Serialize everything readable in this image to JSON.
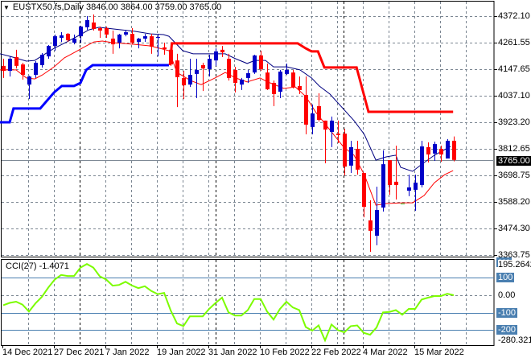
{
  "header": {
    "symbol": "EUSTX50.fs,Daily",
    "open": "3846.00",
    "high": "3864.00",
    "low": "3759.00",
    "close": "3765.00"
  },
  "colors": {
    "bull": "#0000c8",
    "bear": "#ff0000",
    "doji": "#32cd32",
    "ma_fast": "#000080",
    "ma_slow": "#ff0000",
    "stop_long": "#0000ff",
    "stop_short": "#ff0000",
    "cci": "#7cfc00",
    "grid": "#7a8591",
    "level": "#4a7fb0",
    "separator": "#000000"
  },
  "price_axis": {
    "labels": [
      "4372.10",
      "4261.55",
      "4147.65",
      "4037.10",
      "3923.20",
      "3812.65",
      "3698.75",
      "3588.20",
      "3474.30",
      "3363.75"
    ],
    "current": "3765.00"
  },
  "cci_panel": {
    "name": "CCI(27)",
    "value": "-1.4071",
    "axis_max": "195.2642",
    "axis_min": "-280.3219",
    "levels": [
      "200",
      "100",
      "0.00",
      "-100",
      "-200"
    ]
  },
  "date_axis": {
    "labels": [
      "14 Dec 2021",
      "27 Dec 2021",
      "7 Jan 2022",
      "19 Jan 2022",
      "31 Jan 2022",
      "10 Feb 2022",
      "22 Feb 2022",
      "4 Mar 2022",
      "15 Mar 2022"
    ]
  },
  "chart_data": [
    {
      "type": "candlestick",
      "title": "EUSTX50.fs,Daily",
      "ylim": [
        3353.6,
        4440
      ],
      "ohlc_order": [
        "open",
        "high",
        "low",
        "close"
      ],
      "candles": [
        [
          4162,
          4192,
          4111,
          4141
        ],
        [
          4141,
          4202,
          4117,
          4192
        ],
        [
          4199,
          4230,
          4151,
          4162
        ],
        [
          4168,
          4175,
          4104,
          4124
        ],
        [
          4083,
          4120,
          4022,
          4117
        ],
        [
          4124,
          4182,
          4111,
          4175
        ],
        [
          4165,
          4216,
          4155,
          4209
        ],
        [
          4202,
          4250,
          4192,
          4246
        ],
        [
          4246,
          4294,
          4226,
          4287
        ],
        [
          4280,
          4304,
          4263,
          4291
        ],
        [
          4297,
          4301,
          4263,
          4270
        ],
        [
          4260,
          4294,
          4253,
          4277
        ],
        [
          4287,
          4331,
          4260,
          4328
        ],
        [
          4325,
          4372,
          4314,
          4355
        ],
        [
          4345,
          4379,
          4311,
          4318
        ],
        [
          4321,
          4328,
          4280,
          4311
        ],
        [
          4321,
          4328,
          4280,
          4294
        ],
        [
          4277,
          4311,
          4213,
          4253
        ],
        [
          4260,
          4297,
          4236,
          4294
        ],
        [
          4294,
          4314,
          4287,
          4304
        ],
        [
          4297,
          4321,
          4253,
          4260
        ],
        [
          4263,
          4280,
          4236,
          4277
        ],
        [
          4277,
          4297,
          4263,
          4287
        ],
        [
          4287,
          4297,
          4213,
          4243
        ],
        [
          4280,
          4294,
          4202,
          4284
        ],
        [
          4240,
          4260,
          4209,
          4233
        ],
        [
          4230,
          4243,
          4162,
          4168
        ],
        [
          4185,
          4213,
          3988,
          4114
        ],
        [
          4111,
          4141,
          4022,
          4080
        ],
        [
          4083,
          4192,
          4073,
          4124
        ],
        [
          4128,
          4192,
          4026,
          4145
        ],
        [
          4165,
          4175,
          4056,
          4151
        ],
        [
          4148,
          4209,
          4117,
          4192
        ],
        [
          4185,
          4236,
          4162,
          4223
        ],
        [
          4230,
          4246,
          4199,
          4219
        ],
        [
          4192,
          4213,
          4100,
          4111
        ],
        [
          4145,
          4158,
          4050,
          4090
        ],
        [
          4083,
          4111,
          4060,
          4104
        ],
        [
          4111,
          4145,
          4090,
          4131
        ],
        [
          4134,
          4209,
          4128,
          4206
        ],
        [
          4206,
          4226,
          4141,
          4148
        ],
        [
          4134,
          4172,
          4060,
          4063
        ],
        [
          4090,
          4100,
          3992,
          4043
        ],
        [
          4053,
          4145,
          4026,
          4138
        ],
        [
          4128,
          4172,
          4124,
          4145
        ],
        [
          4134,
          4145,
          4067,
          4073
        ],
        [
          4077,
          4117,
          4043,
          4060
        ],
        [
          4039,
          4117,
          3873,
          3914
        ],
        [
          3904,
          3999,
          3873,
          3961
        ],
        [
          3992,
          4046,
          3927,
          3934
        ],
        [
          3931,
          3931,
          3751,
          3893
        ],
        [
          3883,
          3948,
          3819,
          3931
        ],
        [
          3876,
          3931,
          3836,
          3870
        ],
        [
          3876,
          3897,
          3700,
          3737
        ],
        [
          3741,
          3846,
          3710,
          3819
        ],
        [
          3812,
          3846,
          3703,
          3724
        ],
        [
          3710,
          3710,
          3523,
          3567
        ],
        [
          3510,
          3595,
          3377,
          3466
        ],
        [
          3445,
          3652,
          3405,
          3554
        ],
        [
          3564,
          3805,
          3547,
          3747
        ],
        [
          3764,
          3764,
          3618,
          3659
        ],
        [
          3673,
          3825,
          3598,
          3659
        ],
        [
          3581,
          3581,
          3581,
          3581
        ],
        [
          3635,
          3703,
          3612,
          3649
        ],
        [
          3639,
          3703,
          3550,
          3669
        ],
        [
          3659,
          3846,
          3649,
          3822
        ],
        [
          3819,
          3839,
          3754,
          3788
        ],
        [
          3792,
          3842,
          3761,
          3832
        ],
        [
          3812,
          3825,
          3757,
          3788
        ],
        [
          3771,
          3853,
          3771,
          3846
        ],
        [
          3846,
          3864,
          3759,
          3765
        ]
      ],
      "overlays": [
        {
          "name": "ma_fast",
          "points": [
            [
              -0.5,
              4213
            ],
            [
              1.1,
              4202
            ],
            [
              3.6,
              4182
            ],
            [
              4.9,
              4185
            ],
            [
              7.9,
              4236
            ],
            [
              9.9,
              4263
            ],
            [
              12,
              4294
            ],
            [
              13.3,
              4314
            ],
            [
              14.9,
              4325
            ],
            [
              17,
              4318
            ],
            [
              20.4,
              4308
            ],
            [
              22.9,
              4297
            ],
            [
              24.9,
              4294
            ],
            [
              25.75,
              4287
            ],
            [
              27.9,
              4226
            ],
            [
              29.5,
              4213
            ],
            [
              32,
              4213
            ],
            [
              34.5,
              4213
            ],
            [
              36.1,
              4192
            ],
            [
              37.9,
              4172
            ],
            [
              39.1,
              4185
            ],
            [
              40.75,
              4185
            ],
            [
              42,
              4158
            ],
            [
              44.1,
              4158
            ],
            [
              46.1,
              4145
            ],
            [
              47.9,
              4111
            ],
            [
              49.1,
              4077
            ],
            [
              50.75,
              4043
            ],
            [
              54.5,
              3931
            ],
            [
              56.1,
              3873
            ],
            [
              57.9,
              3764
            ],
            [
              59.5,
              3778
            ],
            [
              61,
              3785
            ],
            [
              61.75,
              3734
            ],
            [
              63.6,
              3717
            ],
            [
              64.9,
              3744
            ],
            [
              67,
              3785
            ],
            [
              69.5,
              3822
            ]
          ]
        },
        {
          "name": "ma_slow",
          "points": [
            [
              -0.5,
              4145
            ],
            [
              2,
              4145
            ],
            [
              3.6,
              4111
            ],
            [
              4.9,
              4107
            ],
            [
              6.1,
              4124
            ],
            [
              7.9,
              4158
            ],
            [
              9.5,
              4196
            ],
            [
              11.1,
              4219
            ],
            [
              12.9,
              4246
            ],
            [
              14.1,
              4263
            ],
            [
              15.4,
              4267
            ],
            [
              17,
              4260
            ],
            [
              20.4,
              4253
            ],
            [
              22.9,
              4246
            ],
            [
              25.75,
              4226
            ],
            [
              27,
              4134
            ],
            [
              29.1,
              4100
            ],
            [
              30.75,
              4083
            ],
            [
              32.9,
              4111
            ],
            [
              34.5,
              4134
            ],
            [
              36.1,
              4111
            ],
            [
              37.9,
              4094
            ],
            [
              39.9,
              4111
            ],
            [
              41.1,
              4094
            ],
            [
              43.6,
              4067
            ],
            [
              45.4,
              4073
            ],
            [
              47,
              4033
            ],
            [
              48.6,
              3965
            ],
            [
              50.4,
              3904
            ],
            [
              51.1,
              3880
            ],
            [
              52.9,
              3819
            ],
            [
              54.5,
              3785
            ],
            [
              56.1,
              3703
            ],
            [
              57.9,
              3574
            ],
            [
              59.5,
              3581
            ],
            [
              62,
              3584
            ],
            [
              63.6,
              3584
            ],
            [
              65.4,
              3615
            ],
            [
              67,
              3669
            ],
            [
              68.6,
              3703
            ],
            [
              69.9,
              3720
            ]
          ]
        },
        {
          "name": "stop_long",
          "points": [
            [
              -0.5,
              3924
            ],
            [
              1,
              3924
            ],
            [
              1.6,
              3982
            ],
            [
              5.75,
              3982
            ],
            [
              7.9,
              4050
            ],
            [
              9.1,
              4077
            ],
            [
              11,
              4077
            ],
            [
              12,
              4090
            ],
            [
              12.9,
              4145
            ],
            [
              13.9,
              4165
            ],
            [
              25.75,
              4165
            ]
          ]
        },
        {
          "name": "stop_short",
          "points": [
            [
              25.9,
              4165
            ],
            [
              26.2,
              4257
            ],
            [
              45.75,
              4257
            ],
            [
              47,
              4236
            ],
            [
              47.9,
              4223
            ],
            [
              48.9,
              4223
            ],
            [
              49.9,
              4155
            ],
            [
              54.9,
              4155
            ],
            [
              56.75,
              3968
            ],
            [
              69.9,
              3968
            ]
          ]
        }
      ],
      "current_price": 3765
    },
    {
      "type": "line",
      "title": "CCI(27)",
      "ylim": [
        -280.3219,
        195.2642
      ],
      "levels": [
        100,
        0,
        -100,
        -200
      ],
      "values": [
        -58,
        -45,
        -38,
        -55,
        -94,
        -48,
        -11,
        42,
        88,
        114,
        108,
        108,
        156,
        176,
        156,
        106,
        88,
        53,
        57,
        75,
        54,
        39,
        50,
        23,
        5,
        12,
        -86,
        -162,
        -177,
        -121,
        -121,
        -121,
        -79,
        -45,
        -15,
        -99,
        -117,
        -117,
        -86,
        -23,
        -23,
        -94,
        -140,
        -79,
        -38,
        -71,
        -86,
        -182,
        -203,
        -173,
        -258,
        -168,
        -200,
        -212,
        -177,
        -173,
        -215,
        -226,
        -185,
        -99,
        -96,
        -86,
        -112,
        -79,
        -79,
        -26,
        -15,
        -6,
        -6,
        7,
        -1.4071
      ]
    }
  ]
}
